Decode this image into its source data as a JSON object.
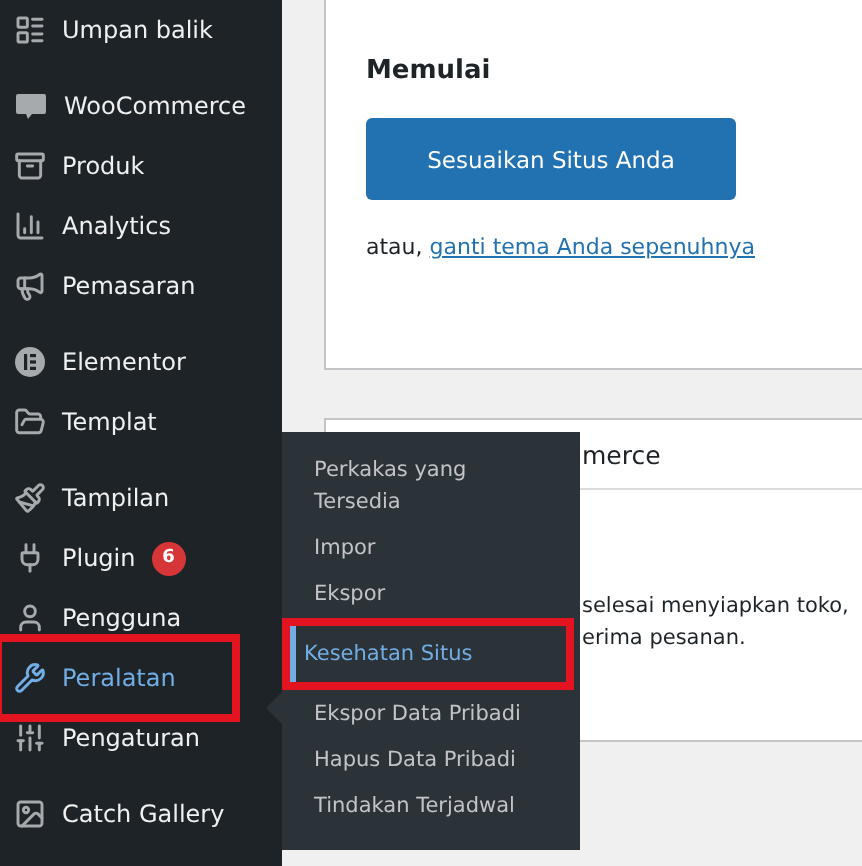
{
  "sidebar": {
    "groups": [
      [
        {
          "label": "Umpan balik",
          "selected": false,
          "highlighted": false
        }
      ],
      [
        {
          "label": "WooCommerce",
          "selected": false,
          "highlighted": false
        },
        {
          "label": "Produk",
          "selected": false,
          "highlighted": false
        },
        {
          "label": "Analytics",
          "selected": false,
          "highlighted": false
        },
        {
          "label": "Pemasaran",
          "selected": false,
          "highlighted": false
        }
      ],
      [
        {
          "label": "Elementor",
          "selected": false,
          "highlighted": false
        },
        {
          "label": "Templat",
          "selected": false,
          "highlighted": false
        }
      ],
      [
        {
          "label": "Tampilan",
          "selected": false,
          "highlighted": false
        },
        {
          "label": "Plugin",
          "badge": "6",
          "selected": false,
          "highlighted": false
        },
        {
          "label": "Pengguna",
          "selected": false,
          "highlighted": false
        },
        {
          "label": "Peralatan",
          "selected": true,
          "highlighted": true
        },
        {
          "label": "Pengaturan",
          "selected": false,
          "highlighted": false
        }
      ],
      [
        {
          "label": "Catch Gallery",
          "selected": false,
          "highlighted": false
        }
      ]
    ]
  },
  "submenu": [
    {
      "label": "Perkakas yang Tersedia",
      "selected": false,
      "highlighted": false
    },
    {
      "label": "Impor",
      "selected": false,
      "highlighted": false
    },
    {
      "label": "Ekspor",
      "selected": false,
      "highlighted": false
    },
    {
      "label": "Kesehatan Situs",
      "selected": true,
      "highlighted": true
    },
    {
      "label": "Ekspor Data Pribadi",
      "selected": false,
      "highlighted": false
    },
    {
      "label": "Hapus Data Pribadi",
      "selected": false,
      "highlighted": false
    },
    {
      "label": "Tindakan Terjadwal",
      "selected": false,
      "highlighted": false
    }
  ],
  "start_card": {
    "heading": "Memulai",
    "button": "Sesuaikan Situs Anda",
    "prefix": "atau,",
    "link": "ganti tema Anda sepenuhnya"
  },
  "store_card": {
    "title_fragment": "merce",
    "lines": [
      "selesai menyiapkan toko,",
      "erima pesanan."
    ]
  }
}
